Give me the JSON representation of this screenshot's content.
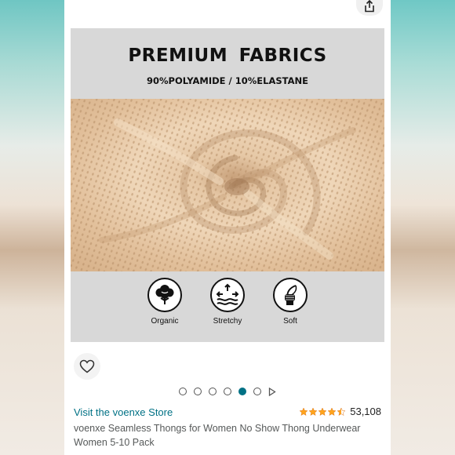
{
  "product_image": {
    "title": "PREMIUM  FABRICS",
    "subtitle": "90%POLYAMIDE / 10%ELASTANE",
    "features": [
      {
        "label": "Organic",
        "icon": "cotton-icon"
      },
      {
        "label": "Stretchy",
        "icon": "stretch-waves-icon"
      },
      {
        "label": "Soft",
        "icon": "hand-feather-icon"
      }
    ]
  },
  "carousel": {
    "dot_count": 6,
    "active_index": 4
  },
  "store": {
    "link_text": "Visit the voenxe Store"
  },
  "rating": {
    "stars": 4.5,
    "count": "53,108"
  },
  "product": {
    "title": "voenxe Seamless Thongs for Women No Show Thong Underwear Women 5-10 Pack"
  },
  "colors": {
    "link": "#007185",
    "star": "#ffa41c",
    "fabric": "#e8c8a4"
  }
}
